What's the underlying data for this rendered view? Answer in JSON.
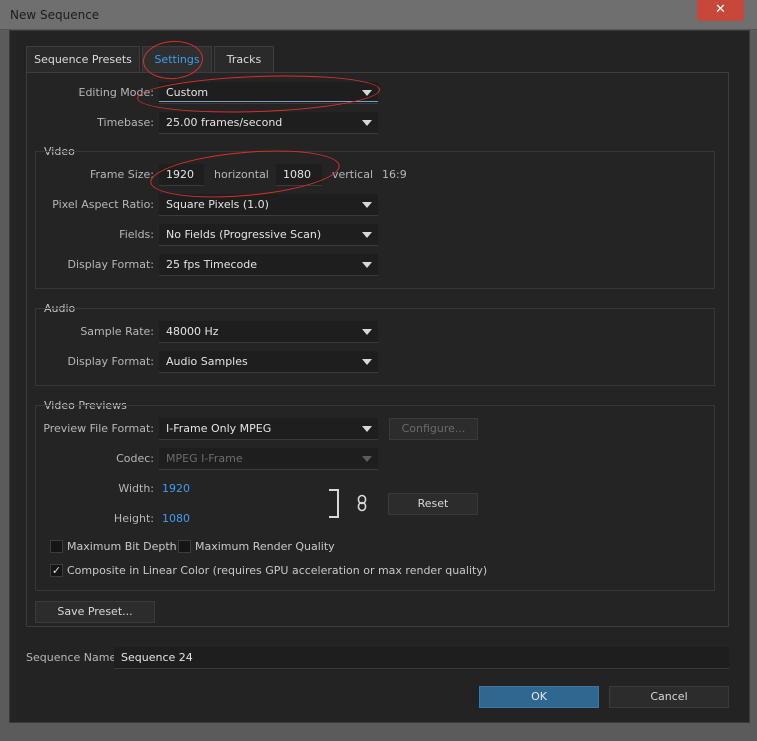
{
  "window": {
    "title": "New Sequence",
    "close_glyph": "✕"
  },
  "tabs": [
    {
      "label": "Sequence Presets"
    },
    {
      "label": "Settings"
    },
    {
      "label": "Tracks"
    }
  ],
  "settings": {
    "editing_mode": {
      "label": "Editing Mode:",
      "value": "Custom"
    },
    "timebase": {
      "label": "Timebase:",
      "value": "25.00 frames/second"
    }
  },
  "video": {
    "title": "Video",
    "frame_size": {
      "label": "Frame Size:",
      "horizontal": "1920",
      "horizontal_label": "horizontal",
      "vertical": "1080",
      "vertical_label": "vertical",
      "aspect": "16:9"
    },
    "pixel_aspect_ratio": {
      "label": "Pixel Aspect Ratio:",
      "value": "Square Pixels (1.0)"
    },
    "fields": {
      "label": "Fields:",
      "value": "No Fields (Progressive Scan)"
    },
    "display_format": {
      "label": "Display Format:",
      "value": "25 fps Timecode"
    }
  },
  "audio": {
    "title": "Audio",
    "sample_rate": {
      "label": "Sample Rate:",
      "value": "48000 Hz"
    },
    "display_format": {
      "label": "Display Format:",
      "value": "Audio Samples"
    }
  },
  "previews": {
    "title": "Video Previews",
    "preview_file_format": {
      "label": "Preview File Format:",
      "value": "I-Frame Only MPEG"
    },
    "configure_label": "Configure...",
    "codec": {
      "label": "Codec:",
      "value": "MPEG I-Frame"
    },
    "width": {
      "label": "Width:",
      "value": "1920"
    },
    "height": {
      "label": "Height:",
      "value": "1080"
    },
    "reset_label": "Reset",
    "max_bit_depth": {
      "label": "Maximum Bit Depth",
      "checked": false
    },
    "max_render_quality": {
      "label": "Maximum Render Quality",
      "checked": false
    },
    "composite_linear": {
      "label": "Composite in Linear Color (requires GPU acceleration or max render quality)",
      "checked": true,
      "check_glyph": "✓"
    }
  },
  "save_preset_label": "Save Preset...",
  "sequence_name": {
    "label": "Sequence Name:",
    "value": "Sequence 24"
  },
  "buttons": {
    "ok": "OK",
    "cancel": "Cancel"
  },
  "colors": {
    "accent": "#3f9cf2",
    "ok_button": "#2f6791",
    "annotation": "#d8302a"
  }
}
